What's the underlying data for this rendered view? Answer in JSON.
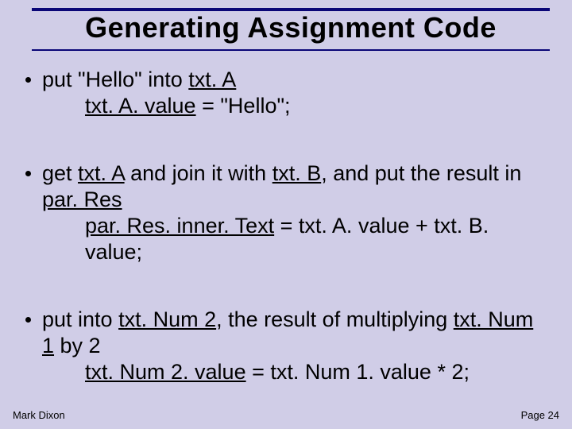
{
  "title": "Generating Assignment Code",
  "bullets": [
    {
      "line1a": "put \"Hello\" into ",
      "line1b": "txt. A",
      "code_u": "txt. A. value",
      "code_rest": " = \"Hello\";"
    },
    {
      "line1a": "get ",
      "line1b": "txt. A",
      "line1c": " and join it with ",
      "line1d": "txt. B",
      "line1e": ", and put the result in ",
      "line1f": "par. Res",
      "code_u": "par. Res. inner. Text",
      "code_rest": " = txt. A. value + txt. B. value;"
    },
    {
      "line1a": "put into ",
      "line1b": "txt. Num 2",
      "line1c": ", the result of multiplying ",
      "line1d": "txt. Num 1",
      "line1e": " by 2",
      "code_u": "txt. Num 2. value",
      "code_rest": " = txt. Num 1. value * 2;"
    }
  ],
  "footer": {
    "author": "Mark Dixon",
    "page": "Page 24"
  }
}
